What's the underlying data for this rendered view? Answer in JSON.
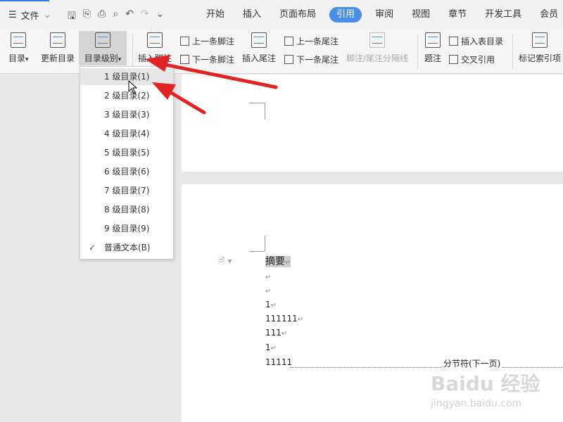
{
  "topbar": {
    "file_menu": "文件",
    "tabs": [
      {
        "label": "开始"
      },
      {
        "label": "插入"
      },
      {
        "label": "页面布局"
      },
      {
        "label": "引用"
      },
      {
        "label": "审阅"
      },
      {
        "label": "视图"
      },
      {
        "label": "章节"
      },
      {
        "label": "开发工具"
      },
      {
        "label": "会员"
      }
    ]
  },
  "ribbon": {
    "toc": "目录",
    "update_toc": "更新目录",
    "toc_level": "目录级别",
    "insert_footnote": "插入脚注",
    "prev_footnote": "上一条脚注",
    "next_footnote": "下一条脚注",
    "insert_endnote": "插入尾注",
    "prev_endnote": "上一条尾注",
    "next_endnote": "下一条尾注",
    "separator_line": "脚注/尾注分隔线",
    "caption": "题注",
    "insert_table_of_figures": "插入表目录",
    "cross_reference": "交叉引用",
    "mark_index": "标记索引项"
  },
  "dropdown": {
    "items": [
      {
        "label": "1 级目录(1)"
      },
      {
        "label": "2 级目录(2)"
      },
      {
        "label": "3 级目录(3)"
      },
      {
        "label": "4 级目录(4)"
      },
      {
        "label": "5 级目录(5)"
      },
      {
        "label": "6 级目录(6)"
      },
      {
        "label": "7 级目录(7)"
      },
      {
        "label": "8 级目录(8)"
      },
      {
        "label": "9 级目录(9)"
      },
      {
        "label": "普通文本(B)"
      }
    ]
  },
  "document": {
    "heading": "摘要",
    "lines": [
      "1",
      "111111",
      "111",
      "1",
      "11111"
    ],
    "section_break": "分节符(下一页)"
  },
  "watermark": {
    "brand": "Baidu 经验",
    "url": "jingyan.baidu.com"
  },
  "colors": {
    "accent": "#4a8fe6",
    "arrow": "#e02424"
  }
}
